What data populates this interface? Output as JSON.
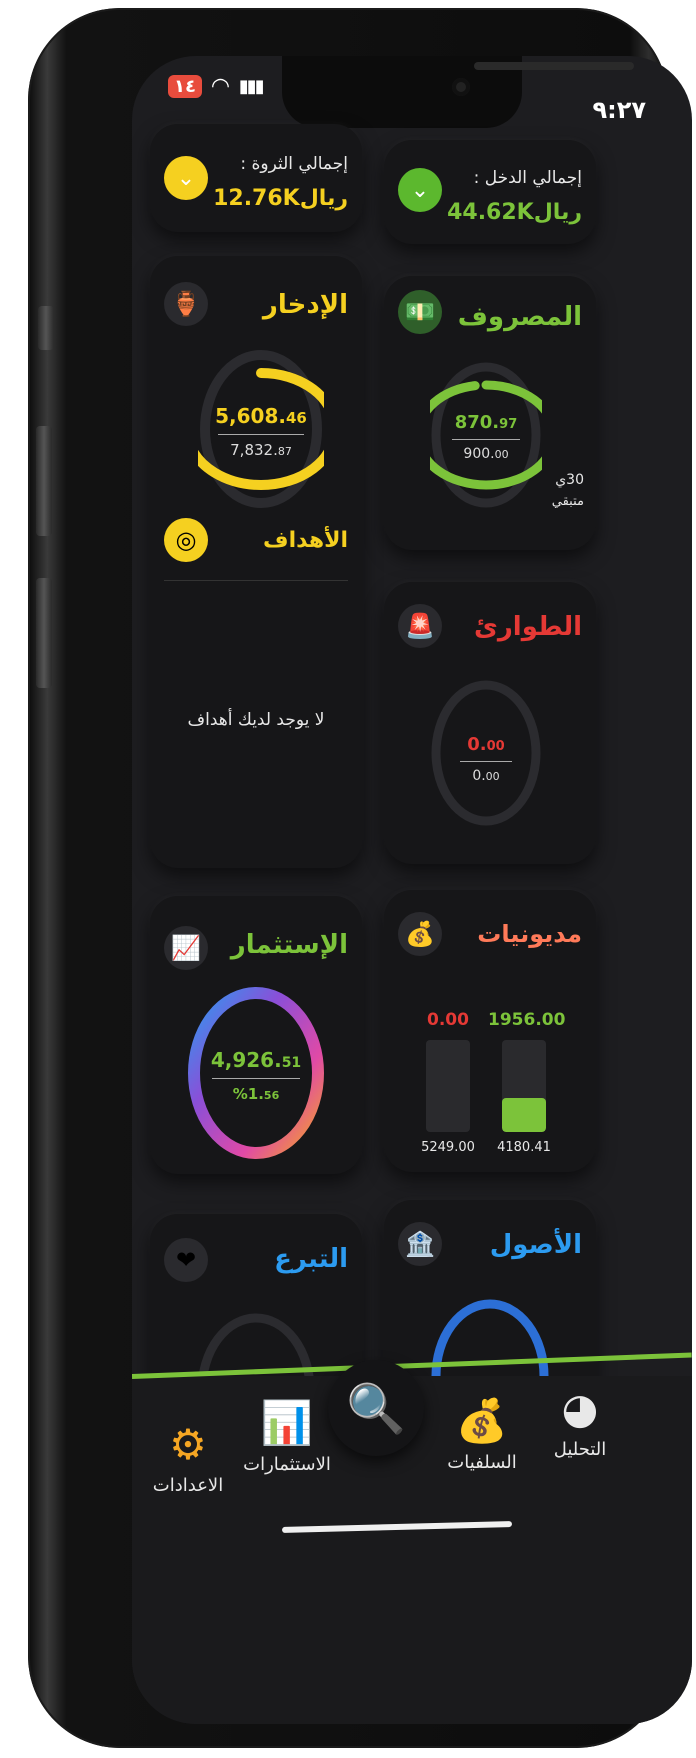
{
  "status_bar": {
    "time": "٩:٢٧",
    "battery": "١٤"
  },
  "totals": {
    "income": {
      "label": "إجمالي الدخل :",
      "value": "44.62K",
      "currency": "ريال"
    },
    "wealth": {
      "label": "إجمالي الثروة :",
      "value": "12.76K",
      "currency": "ريال"
    }
  },
  "expenses": {
    "title": "المصروف",
    "spent_main": "870.",
    "spent_dec": "97",
    "total_main": "900.",
    "total_dec": "00",
    "days": "30ي",
    "days_label": "متبقي",
    "progress": 0.97
  },
  "savings": {
    "title": "الإدخار",
    "saved_main": "5,608.",
    "saved_dec": "46",
    "total_main": "7,832.",
    "total_dec": "87",
    "progress": 0.72
  },
  "goals": {
    "title": "الأهداف",
    "empty_text": "لا يوجد لديك أهداف"
  },
  "emergency": {
    "title": "الطوارئ",
    "value_main": "0.",
    "value_dec": "00",
    "total_main": "0.",
    "total_dec": "00"
  },
  "investment": {
    "title": "الإستثمار",
    "value_main": "4,926.",
    "value_dec": "51",
    "percent_main": "%1.",
    "percent_dec": "56"
  },
  "debts": {
    "title": "مديونيات",
    "bars": [
      {
        "top_value": "1956.00",
        "bottom_value": "4180.41",
        "fill": 0.37,
        "color": "#7cc33a"
      },
      {
        "top_value": "0.00",
        "bottom_value": "5249.00",
        "fill": 0.0,
        "color": "#e53935"
      }
    ]
  },
  "donation": {
    "title": "التبرع"
  },
  "assets": {
    "title": "الأصول"
  },
  "nav": {
    "analysis": "التحليل",
    "advances": "السلفيات",
    "investments": "الاستثمارات",
    "settings": "الاعدادات"
  },
  "colors": {
    "green": "#7cc33a",
    "yellow": "#f5d020",
    "red": "#e53935",
    "salmon": "#ff7a59",
    "blue": "#2c9bf0"
  }
}
